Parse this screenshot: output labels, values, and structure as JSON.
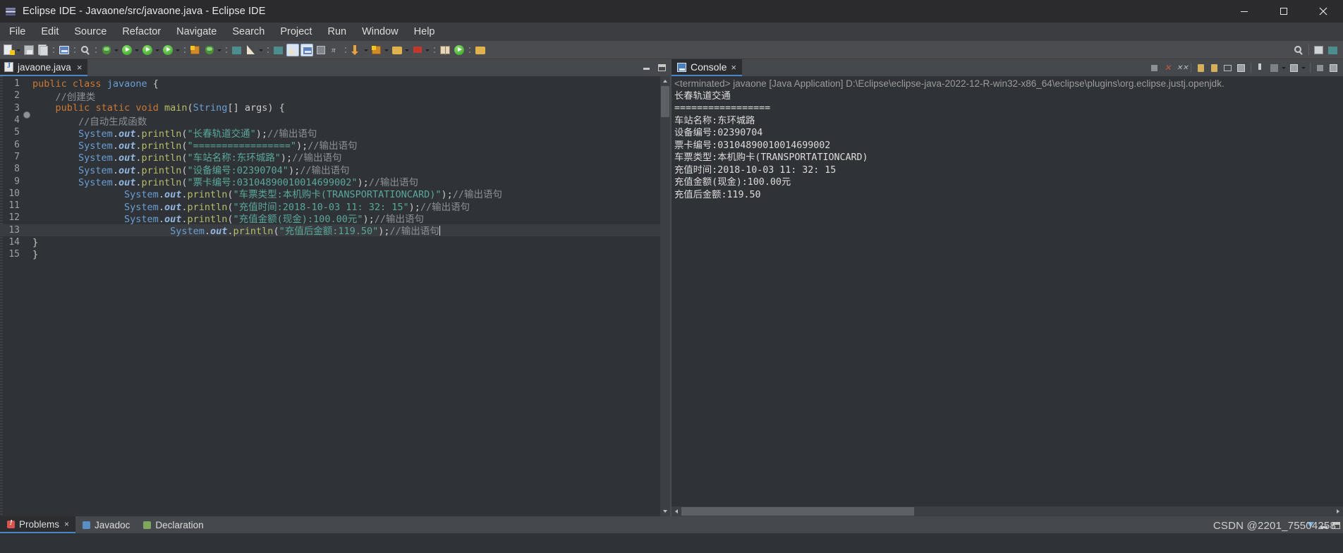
{
  "window": {
    "title": "Eclipse IDE - Javaone/src/javaone.java - Eclipse IDE",
    "app_icon": "eclipse-icon",
    "controls": {
      "minimize": "minimize-icon",
      "maximize": "maximize-icon",
      "close": "close-icon"
    }
  },
  "menubar": {
    "items": [
      {
        "label": "File"
      },
      {
        "label": "Edit"
      },
      {
        "label": "Source"
      },
      {
        "label": "Refactor"
      },
      {
        "label": "Navigate"
      },
      {
        "label": "Search"
      },
      {
        "label": "Project"
      },
      {
        "label": "Run"
      },
      {
        "label": "Window"
      },
      {
        "label": "Help"
      }
    ]
  },
  "toolbar": {
    "groups": [
      {
        "items": [
          {
            "icon": "new-file-icon",
            "arrow": true
          },
          {
            "icon": "save-icon",
            "arrow": false
          },
          {
            "icon": "save-all-icon",
            "arrow": false
          }
        ]
      },
      {
        "items": [
          {
            "icon": "print-icon",
            "arrow": false
          }
        ]
      },
      {
        "items": [
          {
            "icon": "undo-icon",
            "arrow": false
          }
        ]
      },
      {
        "items": [
          {
            "icon": "debug-icon",
            "arrow": true
          },
          {
            "icon": "run-icon",
            "arrow": true
          },
          {
            "icon": "run-external-icon",
            "arrow": true
          },
          {
            "icon": "run-coverage-icon",
            "arrow": true
          }
        ]
      },
      {
        "items": [
          {
            "icon": "new-java-project-icon",
            "arrow": false
          },
          {
            "icon": "new-package-icon",
            "arrow": true
          }
        ]
      },
      {
        "items": [
          {
            "icon": "new-class-icon",
            "arrow": true
          },
          {
            "icon": "search-icon",
            "arrow": true
          }
        ]
      },
      {
        "items": [
          {
            "icon": "open-type-icon",
            "arrow": false
          },
          {
            "icon": "editor-pencil-icon",
            "arrow": false,
            "selected": true
          },
          {
            "icon": "outline-toggle-icon",
            "arrow": false,
            "selected": true
          },
          {
            "icon": "table-view-icon",
            "arrow": false
          },
          {
            "icon": "pi-symbol-icon",
            "arrow": false
          }
        ]
      },
      {
        "items": [
          {
            "icon": "next-annotation-icon",
            "arrow": true
          },
          {
            "icon": "previous-edit-icon",
            "arrow": true
          }
        ]
      },
      {
        "items": [
          {
            "icon": "back-icon",
            "arrow": true
          },
          {
            "icon": "forward-icon",
            "arrow": true
          }
        ]
      },
      {
        "items": [
          {
            "icon": "perspective-icon",
            "arrow": false
          }
        ]
      }
    ],
    "right_items": [
      {
        "icon": "quick-access-search-icon"
      },
      {
        "icon": "open-perspective-icon"
      },
      {
        "icon": "java-perspective-icon"
      }
    ]
  },
  "editor": {
    "tab": {
      "label": "javaone.java",
      "icon": "java-file-icon",
      "close": "×"
    },
    "view_controls": {
      "minimize": "minimize-icon",
      "maximize": "maximize-icon"
    },
    "current_line": 13,
    "lines": [
      {
        "num": "1",
        "marker": "none",
        "indent": 0,
        "tokens": [
          {
            "t": "public",
            "c": "kw"
          },
          {
            "t": " ",
            "c": "pun"
          },
          {
            "t": "class",
            "c": "kw"
          },
          {
            "t": " ",
            "c": "pun"
          },
          {
            "t": "javaone",
            "c": "typ"
          },
          {
            "t": " {",
            "c": "pun"
          }
        ]
      },
      {
        "num": "2",
        "marker": "none",
        "indent": 1,
        "tokens": [
          {
            "t": "//创建类",
            "c": "cmt"
          }
        ]
      },
      {
        "num": "3",
        "marker": "bullet",
        "indent": 1,
        "tokens": [
          {
            "t": "public",
            "c": "kw"
          },
          {
            "t": " ",
            "c": "pun"
          },
          {
            "t": "static",
            "c": "kw"
          },
          {
            "t": " ",
            "c": "pun"
          },
          {
            "t": "void",
            "c": "kw"
          },
          {
            "t": " ",
            "c": "pun"
          },
          {
            "t": "main",
            "c": "mth"
          },
          {
            "t": "(",
            "c": "pun"
          },
          {
            "t": "String",
            "c": "typ"
          },
          {
            "t": "[] args) {",
            "c": "pun"
          }
        ]
      },
      {
        "num": "4",
        "marker": "none",
        "indent": 2,
        "tokens": [
          {
            "t": "//自动生成函数",
            "c": "cmt"
          }
        ]
      },
      {
        "num": "5",
        "marker": "none",
        "indent": 2,
        "tokens": [
          {
            "t": "System",
            "c": "sys"
          },
          {
            "t": ".",
            "c": "pun"
          },
          {
            "t": "out",
            "c": "fld"
          },
          {
            "t": ".",
            "c": "pun"
          },
          {
            "t": "println",
            "c": "mth"
          },
          {
            "t": "(",
            "c": "pun"
          },
          {
            "t": "\"长春轨道交通\"",
            "c": "str"
          },
          {
            "t": ");",
            "c": "pun"
          },
          {
            "t": "//输出语句",
            "c": "cmt"
          }
        ]
      },
      {
        "num": "6",
        "marker": "none",
        "indent": 2,
        "tokens": [
          {
            "t": "System",
            "c": "sys"
          },
          {
            "t": ".",
            "c": "pun"
          },
          {
            "t": "out",
            "c": "fld"
          },
          {
            "t": ".",
            "c": "pun"
          },
          {
            "t": "println",
            "c": "mth"
          },
          {
            "t": "(",
            "c": "pun"
          },
          {
            "t": "\"=================\"",
            "c": "str"
          },
          {
            "t": ");",
            "c": "pun"
          },
          {
            "t": "//输出语句",
            "c": "cmt"
          }
        ]
      },
      {
        "num": "7",
        "marker": "none",
        "indent": 2,
        "tokens": [
          {
            "t": "System",
            "c": "sys"
          },
          {
            "t": ".",
            "c": "pun"
          },
          {
            "t": "out",
            "c": "fld"
          },
          {
            "t": ".",
            "c": "pun"
          },
          {
            "t": "println",
            "c": "mth"
          },
          {
            "t": "(",
            "c": "pun"
          },
          {
            "t": "\"车站名称:东环城路\"",
            "c": "str"
          },
          {
            "t": ");",
            "c": "pun"
          },
          {
            "t": "//输出语句",
            "c": "cmt"
          }
        ]
      },
      {
        "num": "8",
        "marker": "none",
        "indent": 2,
        "tokens": [
          {
            "t": "System",
            "c": "sys"
          },
          {
            "t": ".",
            "c": "pun"
          },
          {
            "t": "out",
            "c": "fld"
          },
          {
            "t": ".",
            "c": "pun"
          },
          {
            "t": "println",
            "c": "mth"
          },
          {
            "t": "(",
            "c": "pun"
          },
          {
            "t": "\"设备编号:02390704\"",
            "c": "str"
          },
          {
            "t": ");",
            "c": "pun"
          },
          {
            "t": "//输出语句",
            "c": "cmt"
          }
        ]
      },
      {
        "num": "9",
        "marker": "none",
        "indent": 2,
        "tokens": [
          {
            "t": "System",
            "c": "sys"
          },
          {
            "t": ".",
            "c": "pun"
          },
          {
            "t": "out",
            "c": "fld"
          },
          {
            "t": ".",
            "c": "pun"
          },
          {
            "t": "println",
            "c": "mth"
          },
          {
            "t": "(",
            "c": "pun"
          },
          {
            "t": "\"票卡编号:03104890010014699002\"",
            "c": "str"
          },
          {
            "t": ");",
            "c": "pun"
          },
          {
            "t": "//输出语句",
            "c": "cmt"
          }
        ]
      },
      {
        "num": "10",
        "marker": "none",
        "indent": 4,
        "tokens": [
          {
            "t": "System",
            "c": "sys"
          },
          {
            "t": ".",
            "c": "pun"
          },
          {
            "t": "out",
            "c": "fld"
          },
          {
            "t": ".",
            "c": "pun"
          },
          {
            "t": "println",
            "c": "mth"
          },
          {
            "t": "(",
            "c": "pun"
          },
          {
            "t": "\"车票类型:本机购卡(TRANSPORTATIONCARD)\"",
            "c": "str"
          },
          {
            "t": ");",
            "c": "pun"
          },
          {
            "t": "//输出语句",
            "c": "cmt"
          }
        ]
      },
      {
        "num": "11",
        "marker": "none",
        "indent": 4,
        "tokens": [
          {
            "t": "System",
            "c": "sys"
          },
          {
            "t": ".",
            "c": "pun"
          },
          {
            "t": "out",
            "c": "fld"
          },
          {
            "t": ".",
            "c": "pun"
          },
          {
            "t": "println",
            "c": "mth"
          },
          {
            "t": "(",
            "c": "pun"
          },
          {
            "t": "\"充值时间:2018-10-03 11: 32: 15\"",
            "c": "str"
          },
          {
            "t": ");",
            "c": "pun"
          },
          {
            "t": "//输出语句",
            "c": "cmt"
          }
        ]
      },
      {
        "num": "12",
        "marker": "none",
        "indent": 4,
        "tokens": [
          {
            "t": "System",
            "c": "sys"
          },
          {
            "t": ".",
            "c": "pun"
          },
          {
            "t": "out",
            "c": "fld"
          },
          {
            "t": ".",
            "c": "pun"
          },
          {
            "t": "println",
            "c": "mth"
          },
          {
            "t": "(",
            "c": "pun"
          },
          {
            "t": "\"充值金额(现金):100.00元\"",
            "c": "str"
          },
          {
            "t": ");",
            "c": "pun"
          },
          {
            "t": "//输出语句",
            "c": "cmt"
          }
        ]
      },
      {
        "num": "13",
        "marker": "none",
        "indent": 6,
        "caret": true,
        "tokens": [
          {
            "t": "System",
            "c": "sys"
          },
          {
            "t": ".",
            "c": "pun"
          },
          {
            "t": "out",
            "c": "fld"
          },
          {
            "t": ".",
            "c": "pun"
          },
          {
            "t": "println",
            "c": "mth"
          },
          {
            "t": "(",
            "c": "pun"
          },
          {
            "t": "\"充值后金额:119.50\"",
            "c": "str"
          },
          {
            "t": ");",
            "c": "pun"
          },
          {
            "t": "//输出语句",
            "c": "cmt"
          }
        ]
      },
      {
        "num": "14",
        "marker": "none",
        "indent": 0,
        "tokens": [
          {
            "t": "}",
            "c": "pun"
          }
        ]
      },
      {
        "num": "15",
        "marker": "none",
        "indent": 0,
        "tokens": [
          {
            "t": "}",
            "c": "pun"
          }
        ]
      }
    ]
  },
  "console": {
    "tab": {
      "label": "Console",
      "icon": "console-icon",
      "close": "×"
    },
    "toolbar_icons": [
      "terminate-icon",
      "terminate-all-icon",
      "remove-launch-icon",
      "remove-all-terminated-icon",
      "clear-console-icon",
      "scroll-lock-icon",
      "word-wrap-icon",
      "show-console-on-output-icon",
      "pin-console-icon",
      "display-selected-console-icon",
      "open-console-icon",
      "minimize-icon",
      "maximize-icon"
    ],
    "terminated_line": "<terminated> javaone [Java Application] D:\\Eclipse\\eclipse-java-2022-12-R-win32-x86_64\\eclipse\\plugins\\org.eclipse.justj.openjdk.",
    "output_lines": [
      "长春轨道交通",
      "=================",
      "车站名称:东环城路",
      "设备编号:02390704",
      "票卡编号:03104890010014699002",
      "车票类型:本机购卡(TRANSPORTATIONCARD)",
      "充值时间:2018-10-03 11: 32: 15",
      "充值金额(现金):100.00元",
      "充值后金额:119.50"
    ]
  },
  "bottom_panel": {
    "tabs": [
      {
        "label": "Problems",
        "icon": "problems-icon",
        "active": true,
        "close": "×"
      },
      {
        "label": "Javadoc",
        "icon": "javadoc-icon",
        "active": false,
        "close": ""
      },
      {
        "label": "Declaration",
        "icon": "declaration-icon",
        "active": false,
        "close": ""
      }
    ],
    "tools": [
      "filter-icon",
      "minimize-icon",
      "maximize-icon"
    ]
  },
  "watermark": "CSDN @2201_75504258",
  "colors": {
    "accent": "#4a88c7",
    "titlebar_bg": "#2b2b2e",
    "menubar_bg": "#3b3d40",
    "toolbar_bg": "#4a4c50",
    "editor_bg": "#2f3337",
    "current_line_bg": "#393c40",
    "keyword": "#cc7832",
    "type": "#6a9fd4",
    "method": "#b5bd68",
    "string": "#5aa79a",
    "comment": "#8b9197"
  }
}
